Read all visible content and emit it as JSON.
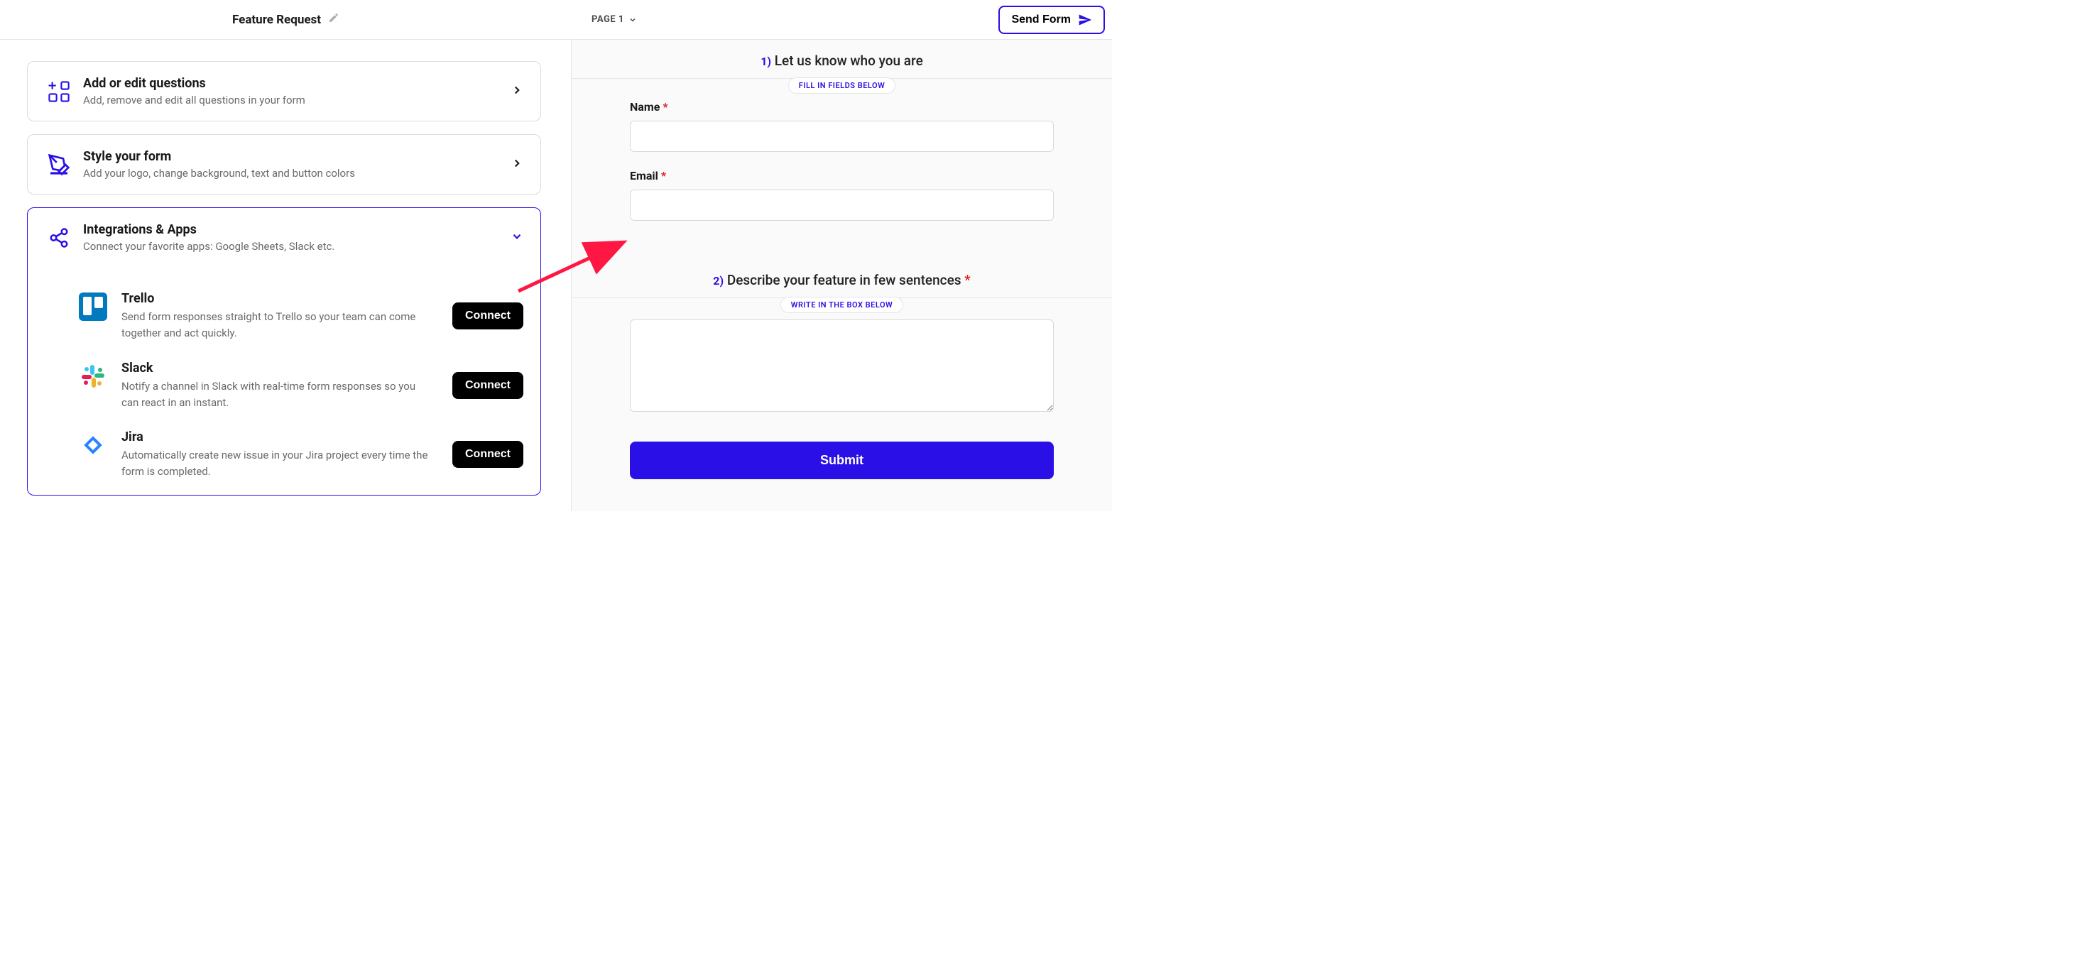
{
  "header": {
    "title": "Feature Request",
    "page_label": "PAGE 1",
    "send_label": "Send Form"
  },
  "settings": {
    "questions": {
      "title": "Add or edit questions",
      "desc": "Add, remove and edit all questions in your form"
    },
    "style": {
      "title": "Style your form",
      "desc": "Add your logo, change background, text and button colors"
    },
    "integrations": {
      "title": "Integrations & Apps",
      "desc": "Connect your favorite apps: Google Sheets, Slack etc.",
      "apps": [
        {
          "name": "Trello",
          "desc": "Send form responses straight to Trello so your team can come together and act quickly.",
          "connect": "Connect"
        },
        {
          "name": "Slack",
          "desc": "Notify a channel in Slack with real-time form responses so you can react in an instant.",
          "connect": "Connect"
        },
        {
          "name": "Jira",
          "desc": "Automatically create new issue in your Jira project every time the form is completed.",
          "connect": "Connect"
        }
      ]
    }
  },
  "form": {
    "section1": {
      "num": "1)",
      "title": "Let us know who you are",
      "hint": "FILL IN FIELDS BELOW",
      "name_label": "Name",
      "email_label": "Email"
    },
    "section2": {
      "num": "2)",
      "title": "Describe your feature in few sentences",
      "hint": "WRITE IN THE BOX BELOW"
    },
    "submit_label": "Submit"
  }
}
